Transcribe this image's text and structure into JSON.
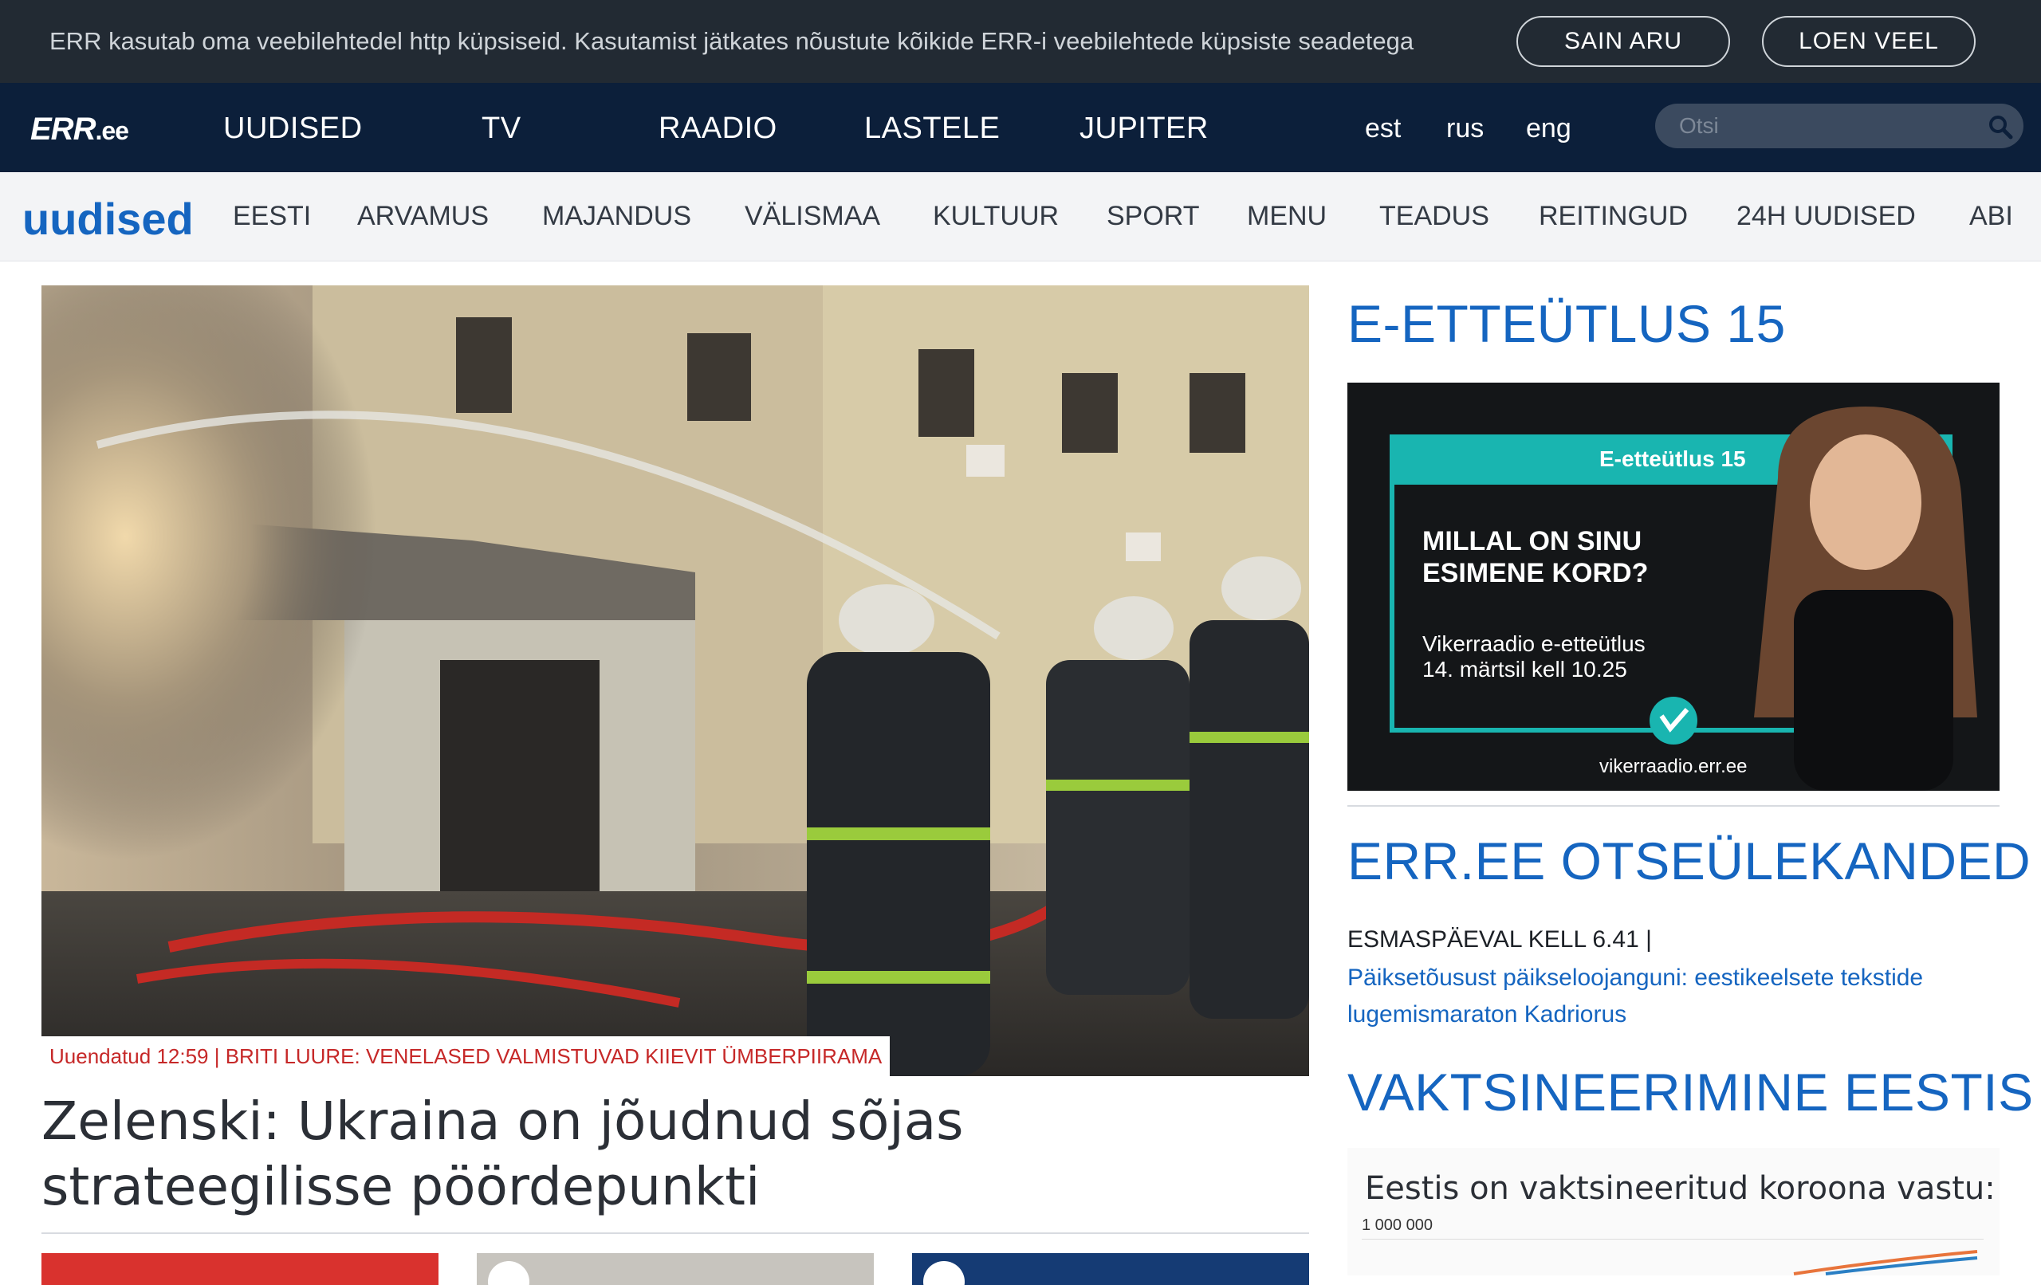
{
  "cookie": {
    "text": "ERR kasutab oma veebilehtedel http küpsiseid. Kasutamist jätkates nõustute kõikide ERR-i veebilehtede küpsiste seadetega",
    "accept_label": "SAIN ARU",
    "more_label": "LOEN VEEL"
  },
  "header": {
    "logo_main": "ERR",
    "logo_suffix": ".ee",
    "nav": [
      "UUDISED",
      "TV",
      "RAADIO",
      "LASTELE",
      "JUPITER"
    ],
    "languages": [
      "est",
      "rus",
      "eng"
    ],
    "search_placeholder": "Otsi"
  },
  "subnav": {
    "section": "uudised",
    "items": [
      "EESTI",
      "ARVAMUS",
      "MAJANDUS",
      "VÄLISMAA",
      "KULTUUR",
      "SPORT",
      "MENU",
      "TEADUS",
      "REITINGUD",
      "24H UUDISED",
      "ABI"
    ]
  },
  "main": {
    "caption": "Uuendatud 12:59 | BRITI LUURE: VENELASED VALMISTUVAD KIIEVIT ÜMBERPIIRAMA",
    "headline": "Zelenski: Ukraina on jõudnud sõjas strateegilisse pöördepunkti"
  },
  "sidebar": {
    "promo_title": "E-ETTEÜTLUS 15",
    "ad": {
      "badge": "E-etteütlus 15",
      "line1": "MILLAL ON SINU",
      "line2": "ESIMENE KORD?",
      "sub1": "Vikerraadio e-etteütlus",
      "sub2": "14. märtsil kell 10.25",
      "site": "vikerraadio.err.ee",
      "accent_color": "#19b5b0"
    },
    "live_title": "ERR.EE OTSEÜLEKANDED",
    "live_time": "ESMASPÄEVAL KELL 6.41 |",
    "live_link": "Päiksetõusust päikseloojanguni: eestikeelsete tekstide lugemismaraton Kadriorus",
    "vax_title": "VAKTSINEERIMINE EESTIS",
    "vax_heading": "Eestis on vaktsineeritud koroona vastu:",
    "vax_tick": "1 000 000"
  },
  "colors": {
    "cookie_bg": "#222a33",
    "nav_bg": "#0c1f3a",
    "brand_blue": "#1565c0",
    "caption_red": "#c62828"
  }
}
